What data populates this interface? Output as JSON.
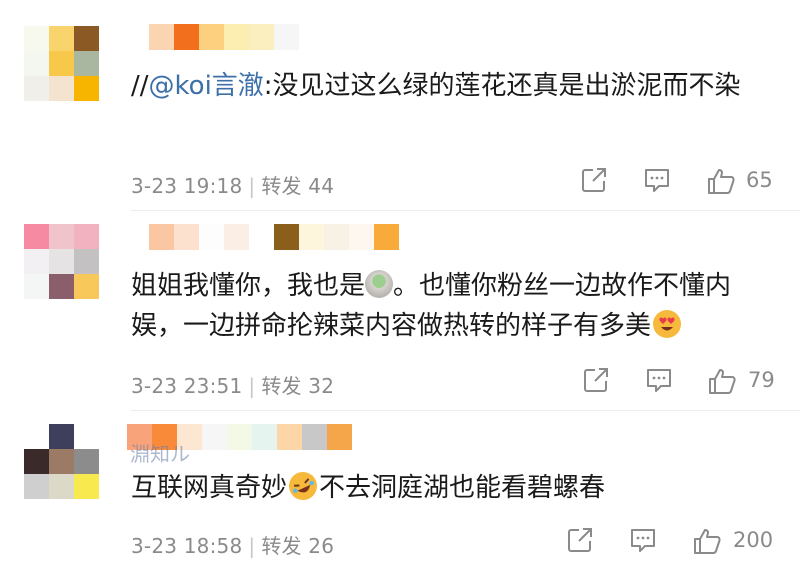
{
  "comments": [
    {
      "avatar_colors": [
        "#f7f9ef",
        "#f9d36b",
        "#8b5a24",
        "#f4f6f0",
        "#f8c84a",
        "#a9b7a0",
        "#f1efe9",
        "#f3e3cf",
        "#f7b500"
      ],
      "name_colors": [
        "#fbd5b1",
        "#f26f1d",
        "#fcd07e",
        "#fbeeb0",
        "#fbefbf",
        "#f6f6f6"
      ],
      "prefix": "//",
      "mention": "@koi言澈",
      "text": ":没见过这么绿的莲花还真是出淤泥而不染",
      "date": "3-23 19:18",
      "repost_label": "转发 44",
      "like_count": "65"
    },
    {
      "avatar_colors": [
        "#f68aa2",
        "#f1c4cc",
        "#f2b2bf",
        "#f2f0f3",
        "#e6e3e4",
        "#c4c1c3",
        "#f4f6f6",
        "#8a5f6b",
        "#f8c95a"
      ],
      "name_colors": [
        "#fbc7a3",
        "#fbe1ce",
        "#fdfdfd",
        "#fbefe5",
        "#ffffff",
        "#8a5f1c",
        "#fef6dc",
        "#f8f1e6",
        "#fdf7f0",
        "#f8aa3a"
      ],
      "text_a": "姐姐我懂你，我也是",
      "text_b": "。也懂你粉丝一边故作不懂内娱，一边拼命抡辣菜内容做热转的样子有多美",
      "tea_emoji": "tea-emoji",
      "heart_eyes_emoji": "heart-eyes-emoji",
      "date": "3-23 23:51",
      "repost_label": "转发 32",
      "like_count": "79"
    },
    {
      "avatar_colors": [
        "#ffffff",
        "#3d3f5c",
        "#ffffff",
        "#3a2a2a",
        "#9b7a66",
        "#8c8c8c",
        "#cfcfcf",
        "#ddd9c9",
        "#f8ea4e"
      ],
      "name_colors": [
        "#f8a37a",
        "#f98a3a",
        "#fde7d2",
        "#f6f6f6",
        "#f3f9e6",
        "#e5f4ef",
        "#fcd6a6",
        "#c8c8c8",
        "#f6a64a"
      ],
      "name_partial": "淵知ル",
      "text_a": "互联网真奇妙",
      "text_b": "不去洞庭湖也能看碧螺春",
      "laugh_emoji": "rolling-laughing-emoji",
      "date": "3-23 18:58",
      "repost_label": "转发 26",
      "like_count": "200"
    }
  ],
  "icons": {
    "share": "share-icon",
    "comment": "comment-icon",
    "like": "thumbs-up-icon"
  },
  "colors": {
    "mention": "#3d6fa8",
    "meta": "#8a8a8a"
  }
}
